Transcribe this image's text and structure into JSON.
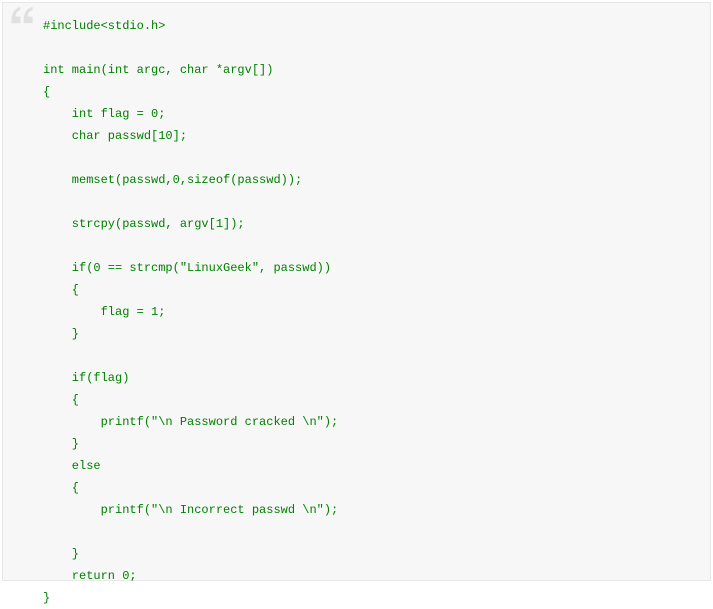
{
  "code": {
    "lines": [
      "#include<stdio.h>",
      "",
      "int main(int argc, char *argv[])",
      "{",
      "    int flag = 0;",
      "    char passwd[10];",
      "",
      "    memset(passwd,0,sizeof(passwd));",
      "",
      "    strcpy(passwd, argv[1]);",
      "",
      "    if(0 == strcmp(\"LinuxGeek\", passwd))",
      "    {",
      "        flag = 1;",
      "    }",
      "",
      "    if(flag)",
      "    {",
      "        printf(\"\\n Password cracked \\n\");",
      "    }",
      "    else",
      "    {",
      "        printf(\"\\n Incorrect passwd \\n\");",
      "",
      "    }",
      "    return 0;",
      "}"
    ]
  },
  "colors": {
    "background": "#f7f7f7",
    "border": "#e8e8e8",
    "text": "#008000",
    "quote": "#e0e0e0"
  }
}
